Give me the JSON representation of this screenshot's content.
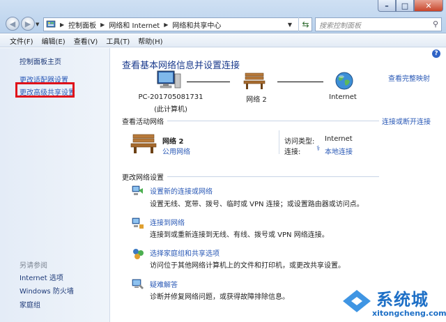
{
  "window": {
    "minimize": "–",
    "maximize": "□",
    "close": "✕"
  },
  "address": {
    "segments": [
      "控制面板",
      "网络和 Internet",
      "网络和共享中心"
    ]
  },
  "search": {
    "placeholder": "搜索控制面板"
  },
  "menu": [
    "文件(F)",
    "编辑(E)",
    "查看(V)",
    "工具(T)",
    "帮助(H)"
  ],
  "left": {
    "home": "控制面板主页",
    "adapter": "更改适配器设置",
    "advanced": "更改高级共享设置",
    "see_also": "另请参阅",
    "links": [
      "Internet 选项",
      "Windows 防火墙",
      "家庭组"
    ]
  },
  "main": {
    "title": "查看基本网络信息并设置连接",
    "view_full_map": "查看完整映射",
    "map": {
      "computer_name": "PC-201705081731",
      "computer_sub": "(此计算机)",
      "network": "网络 2",
      "internet": "Internet"
    },
    "active": {
      "header": "查看活动网络",
      "connect_disconnect": "连接或断开连接",
      "network_name": "网络 2",
      "network_type": "公用网络",
      "access_label": "访问类型:",
      "access_value": "Internet",
      "conn_label": "连接:",
      "conn_value": "本地连接"
    },
    "change": {
      "header": "更改网络设置",
      "tasks": [
        {
          "link": "设置新的连接或网络",
          "desc": "设置无线、宽带、拨号、临时或 VPN 连接；或设置路由器或访问点。"
        },
        {
          "link": "连接到网络",
          "desc": "连接到或重新连接到无线、有线、拨号或 VPN 网络连接。"
        },
        {
          "link": "选择家庭组和共享选项",
          "desc": "访问位于其他网络计算机上的文件和打印机，或更改共享设置。"
        },
        {
          "link": "疑难解答",
          "desc": "诊断并修复网络问题，或获得故障排除信息。"
        }
      ]
    }
  },
  "watermark": {
    "brand": "系统城",
    "url": "xitongcheng.com"
  }
}
